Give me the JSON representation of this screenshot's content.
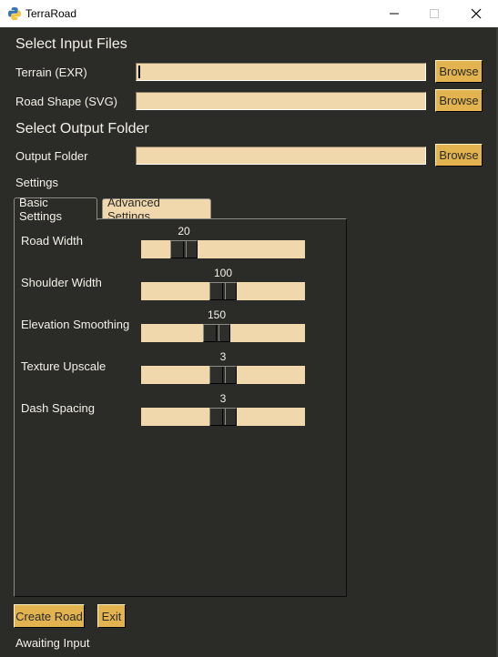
{
  "window": {
    "title": "TerraRoad",
    "icon": "python-icon",
    "controls": {
      "minimize": "minimize-icon",
      "maximize": "maximize-icon",
      "close": "close-icon"
    }
  },
  "input_section": {
    "title": "Select Input Files",
    "fields": [
      {
        "label": "Terrain (EXR)",
        "value": "",
        "button": "Browse"
      },
      {
        "label": "Road Shape (SVG)",
        "value": "",
        "button": "Browse"
      }
    ]
  },
  "output_section": {
    "title": "Select Output Folder",
    "fields": [
      {
        "label": "Output Folder",
        "value": "",
        "button": "Browse"
      }
    ]
  },
  "settings": {
    "title": "Settings",
    "tabs": [
      {
        "label": "Basic Settings",
        "active": true
      },
      {
        "label": "Advanced Settings",
        "active": false
      }
    ],
    "sliders": [
      {
        "label": "Road Width",
        "value": "20",
        "position_fraction": 0.21
      },
      {
        "label": "Shoulder Width",
        "value": "100",
        "position_fraction": 0.5
      },
      {
        "label": "Elevation Smoothing",
        "value": "150",
        "position_fraction": 0.45
      },
      {
        "label": "Texture Upscale",
        "value": "3",
        "position_fraction": 0.5
      },
      {
        "label": "Dash Spacing",
        "value": "3",
        "position_fraction": 0.5
      }
    ]
  },
  "actions": {
    "create_label": "Create Road",
    "exit_label": "Exit"
  },
  "status": "Awaiting Input",
  "colors": {
    "background": "#2b2b27",
    "field": "#f0d7ac",
    "button": "#e2b34e",
    "text": "#f4f1e8"
  }
}
